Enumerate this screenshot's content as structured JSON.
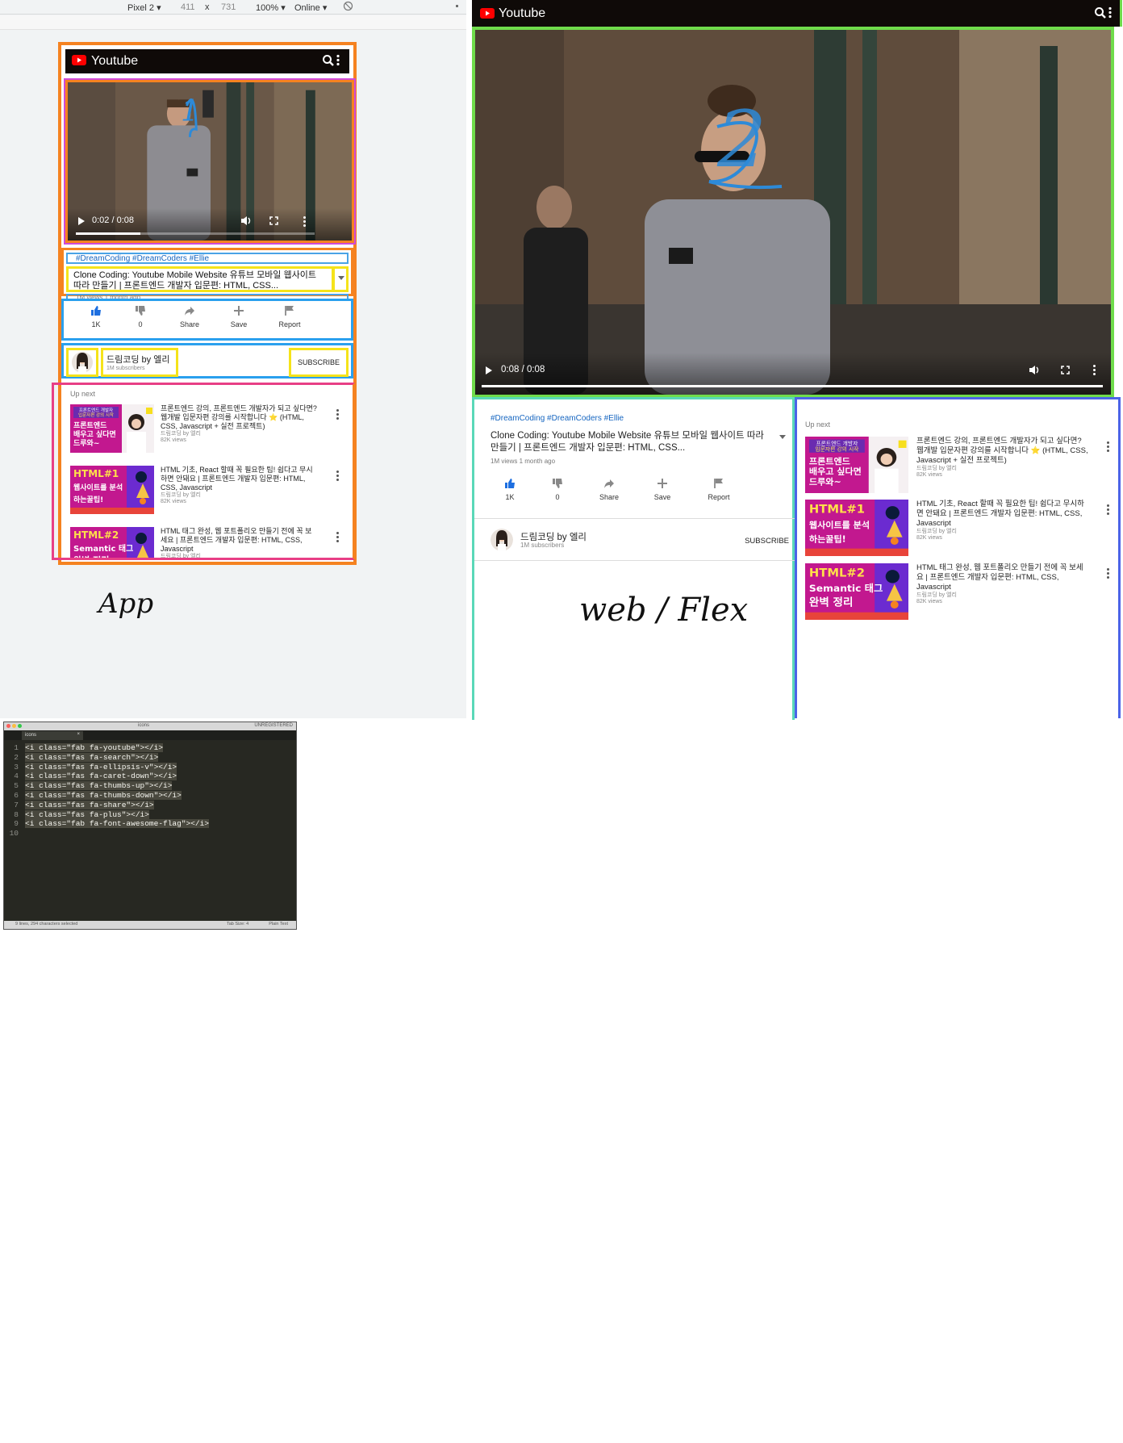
{
  "devtools": {
    "device": "Pixel 2 ▾",
    "width": "411",
    "times": "x",
    "height": "731",
    "zoom": "100% ▾",
    "network": "Online ▾"
  },
  "app": {
    "brand": "Youtube",
    "annotation_number": "1",
    "player": {
      "time": "0:02 / 0:08",
      "progress": 0.27
    },
    "tags": "#DreamCoding #DreamCoders #Ellie",
    "title": "Clone Coding: Youtube Mobile Website 유튜브 모바일 웹사이트 따라 만들기 | 프론트엔드 개발자 입문편: HTML, CSS...",
    "meta": "1M views 1 month ago",
    "actions": [
      {
        "icon": "thumbs-up-icon",
        "label": "1K"
      },
      {
        "icon": "thumbs-down-icon",
        "label": "0"
      },
      {
        "icon": "share-icon",
        "label": "Share"
      },
      {
        "icon": "plus-icon",
        "label": "Save"
      },
      {
        "icon": "flag-icon",
        "label": "Report"
      }
    ],
    "channel": {
      "name": "드림코딩 by 엘리",
      "subscribers": "1M subscribers",
      "subscribe": "SUBSCRIBE"
    },
    "up_next_label": "Up next",
    "up_next": [
      {
        "thumb_kind": "intro",
        "thumb_lines": [
          "프론트엔드 개발자",
          "입문자편 강의 시작",
          "프론트엔드",
          "배우고 싶다면",
          "드루와~"
        ],
        "title": "프론트엔드 강의, 프론트엔드 개발자가 되고 싶다면? 웹개발 입문자편 강의를 시작합니다 ⭐ (HTML, CSS, Javascript + 실전 프로젝트)",
        "channel": "드림코딩 by 엘리",
        "views": "82K views"
      },
      {
        "thumb_kind": "html1",
        "thumb_lines": [
          "HTML#1",
          "웹사이트를 분석",
          "하는꿀팁!"
        ],
        "title": "HTML 기초, React 할때 꼭 필요한 팁! 쉽다고 무시하면 안돼요 | 프론트엔드 개발자 입문편: HTML, CSS, Javascript",
        "channel": "드림코딩 by 엘리",
        "views": "82K views"
      },
      {
        "thumb_kind": "html2",
        "thumb_lines": [
          "HTML#2",
          "Semantic 태그",
          "완벽 정리"
        ],
        "title": "HTML 태그 완성, 웹 포트폴리오 만들기 전에 꼭 보세요 | 프론트엔드 개발자 입문편: HTML, CSS, Javascript",
        "channel": "드림코딩 by 엘리",
        "views": "82K views"
      }
    ],
    "caption": "App"
  },
  "web": {
    "brand": "Youtube",
    "annotation_number": "2",
    "player": {
      "time": "0:08 / 0:08",
      "progress": 1.0
    },
    "caption": "web / Flex"
  },
  "editor": {
    "window_title": "icons",
    "license": "UNREGISTERED",
    "tab": "icons",
    "lines": [
      "<i class=\"fab fa-youtube\"></i>",
      "<i class=\"fas fa-search\"></i>",
      "<i class=\"fas fa-ellipsis-v\"></i>",
      "<i class=\"fas fa-caret-down\"></i>",
      "<i class=\"fas fa-thumbs-up\"></i>",
      "<i class=\"fas fa-thumbs-down\"></i>",
      "<i class=\"fas fa-share\"></i>",
      "<i class=\"fas fa-plus\"></i>",
      "<i class=\"fab fa-font-awesome-flag\"></i>",
      ""
    ],
    "status_left": "9 lines, 294 characters selected",
    "status_mid": "Tab Size: 4",
    "status_right": "Plain Text"
  },
  "colors": {
    "youtube_red": "#ff0000",
    "link_blue": "#1565c0",
    "thumb_up_blue": "#1e6fe0",
    "orange_box": "#f58220",
    "yellow_box": "#f5e31a",
    "blue_box": "#2aa0ee",
    "pink_box": "#e83f86",
    "green_box": "#6fdc4b",
    "teal_box": "#5ad8b8",
    "purple_box": "#4b63e8"
  }
}
